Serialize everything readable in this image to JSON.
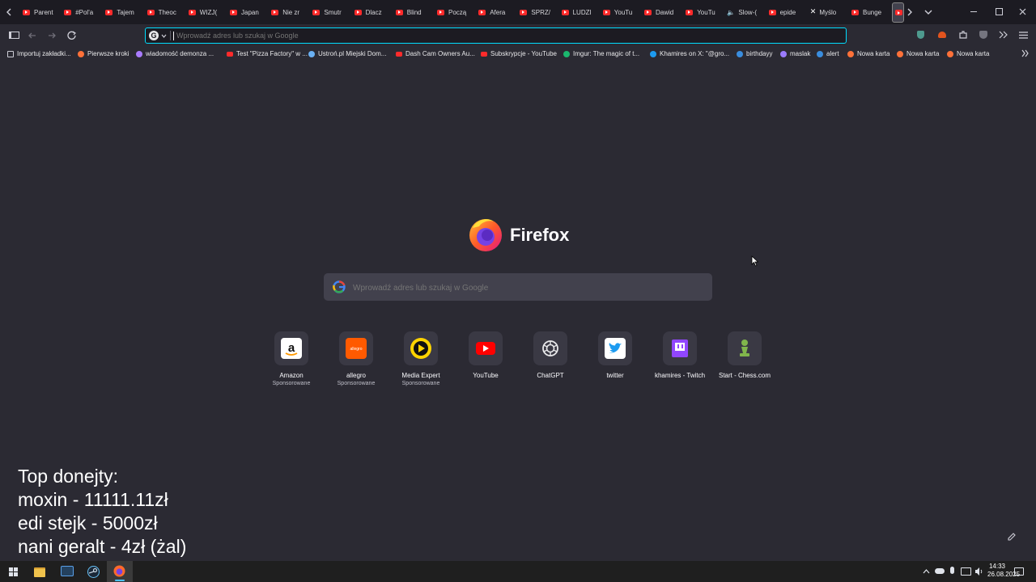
{
  "tabs": [
    {
      "label": "Parent",
      "icon": "youtube-icon"
    },
    {
      "label": "#Pol'a",
      "icon": "youtube-icon"
    },
    {
      "label": "Tajem",
      "icon": "youtube-icon"
    },
    {
      "label": "Theoc",
      "icon": "youtube-icon"
    },
    {
      "label": "WIZJ(",
      "icon": "youtube-icon"
    },
    {
      "label": "Japan",
      "icon": "youtube-icon"
    },
    {
      "label": "Nie zr",
      "icon": "youtube-icon"
    },
    {
      "label": "Smutr",
      "icon": "youtube-icon"
    },
    {
      "label": "Dlacz",
      "icon": "youtube-icon"
    },
    {
      "label": "Blind",
      "icon": "youtube-icon"
    },
    {
      "label": "Począ",
      "icon": "youtube-icon"
    },
    {
      "label": "Afera",
      "icon": "youtube-icon"
    },
    {
      "label": "SPRZ/",
      "icon": "youtube-icon"
    },
    {
      "label": "LUDZI",
      "icon": "youtube-icon"
    },
    {
      "label": "YouTu",
      "icon": "youtube-icon"
    },
    {
      "label": "Dawid",
      "icon": "youtube-icon"
    },
    {
      "label": "YouTu",
      "icon": "youtube-icon"
    },
    {
      "label": "Slow-(",
      "icon": "speaker-icon"
    },
    {
      "label": "epide",
      "icon": "youtube-icon"
    },
    {
      "label": "Myślo",
      "icon": "x-logo-icon"
    },
    {
      "label": "Bunge",
      "icon": "youtube-icon"
    }
  ],
  "address_bar": {
    "placeholder": "Wprowadź adres lub szukaj w Google"
  },
  "bookmarks": [
    {
      "label": "Importuj zakładki...",
      "icon": "import-icon",
      "color": "#cfcfd8"
    },
    {
      "label": "Pierwsze kroki",
      "icon": "firefox-icon",
      "color": "#ff7139"
    },
    {
      "label": "wiadomość demonza ...",
      "icon": "bookmark-icon",
      "color": "#a97bff"
    },
    {
      "label": "Test \"Pizza Factory\" w ...",
      "icon": "youtube-icon",
      "color": "#ff2b2b"
    },
    {
      "label": "Ustroń.pl Miejski Dom...",
      "icon": "shield-icon",
      "color": "#6ab0f3"
    },
    {
      "label": "Dash Cam Owners Au...",
      "icon": "youtube-icon",
      "color": "#ff2b2b"
    },
    {
      "label": "Subskrypcje - YouTube",
      "icon": "youtube-icon",
      "color": "#ff2b2b"
    },
    {
      "label": "Imgur: The magic of t...",
      "icon": "imgur-icon",
      "color": "#1bb76e"
    },
    {
      "label": "Khamires on X: \"@gro...",
      "icon": "twitter-icon",
      "color": "#1d9bf0"
    },
    {
      "label": "birthdayy",
      "icon": "link-icon",
      "color": "#3a8dde"
    },
    {
      "label": "maslak",
      "icon": "pen-icon",
      "color": "#9a7bff"
    },
    {
      "label": "alert",
      "icon": "link-icon",
      "color": "#3a8dde"
    },
    {
      "label": "Nowa karta",
      "icon": "firefox-icon",
      "color": "#ff7139"
    },
    {
      "label": "Nowa karta",
      "icon": "firefox-icon",
      "color": "#ff7139"
    },
    {
      "label": "Nowa karta",
      "icon": "firefox-icon",
      "color": "#ff7139"
    }
  ],
  "brand": {
    "name": "Firefox"
  },
  "search": {
    "placeholder": "Wprowadź adres lub szukaj w Google"
  },
  "shortcuts": [
    {
      "label": "Amazon",
      "sponsor": "Sponsorowane",
      "icon": "amazon-icon"
    },
    {
      "label": "allegro",
      "sponsor": "Sponsorowane",
      "icon": "allegro-icon",
      "logo_text": "allegro"
    },
    {
      "label": "Media Expert",
      "sponsor": "Sponsorowane",
      "icon": "media-expert-icon"
    },
    {
      "label": "YouTube",
      "sponsor": "",
      "icon": "youtube-icon"
    },
    {
      "label": "ChatGPT",
      "sponsor": "",
      "icon": "chatgpt-icon"
    },
    {
      "label": "twitter",
      "sponsor": "",
      "icon": "twitter-icon"
    },
    {
      "label": "khamires - Twitch",
      "sponsor": "",
      "icon": "twitch-icon"
    },
    {
      "label": "Start - Chess.com",
      "sponsor": "",
      "icon": "chess-pawn-icon"
    }
  ],
  "overlay": {
    "lines": [
      "Top donejty:",
      "moxin - 11111.11zł",
      "edi stejk - 5000zł",
      "nani geralt - 4zł (żal)"
    ]
  },
  "clock": {
    "time": "14:33",
    "date": "26.08.2025"
  },
  "colors": {
    "background": "#2b2a33",
    "tabbar": "#1c1b22",
    "accent": "#00ddff",
    "youtube": "#ff2b2b"
  }
}
